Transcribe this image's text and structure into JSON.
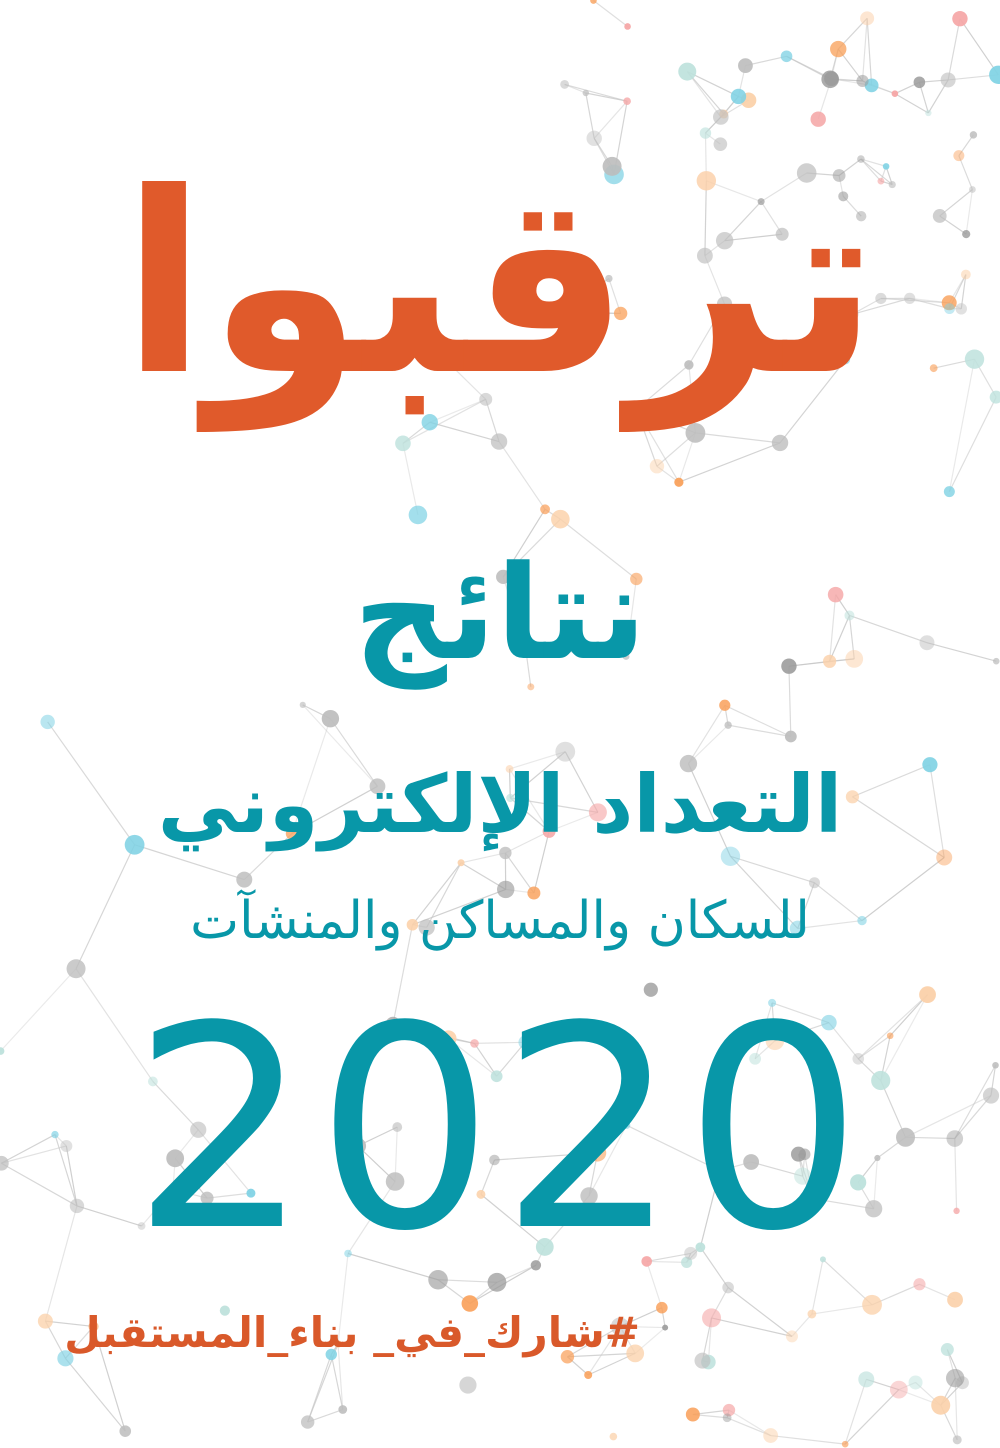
{
  "poster": {
    "headline": "ترقبوا",
    "results": "نتائج",
    "census": "التعداد الإلكتروني",
    "subtitle": "للسكان والمساكن والمنشآت",
    "year": "2020",
    "hashtag": "#شارك_في_ بناء_المستقبل"
  },
  "colors": {
    "headline": "#e05a2b",
    "primary": "#0897a8",
    "hashtag": "#d9592a",
    "network_line": "#c6c6c6",
    "network_node": "#bdbdbd",
    "node_orange": "#f9a05a",
    "node_peach": "#fbd0a8",
    "node_pink": "#f5a6a6",
    "node_cyan": "#7fd2e4",
    "node_teal": "#bde1dc",
    "node_gray_dark": "#9b9b9b"
  },
  "decoration": {
    "background": "network-graph-pattern"
  }
}
